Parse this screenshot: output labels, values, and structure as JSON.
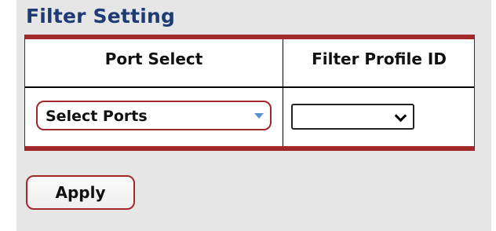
{
  "title": "Filter Setting",
  "table": {
    "headers": [
      "Port Select",
      "Filter Profile ID"
    ],
    "port_select_value": "Select Ports",
    "filter_profile_value": ""
  },
  "actions": {
    "apply_label": "Apply"
  },
  "icons": {
    "port_dropdown": "triangle-down-icon",
    "profile_dropdown": "chevron-down-icon"
  },
  "colors": {
    "accent": "#a3282c",
    "title": "#1f3b73",
    "dropdown_caret": "#5a8fd0"
  }
}
